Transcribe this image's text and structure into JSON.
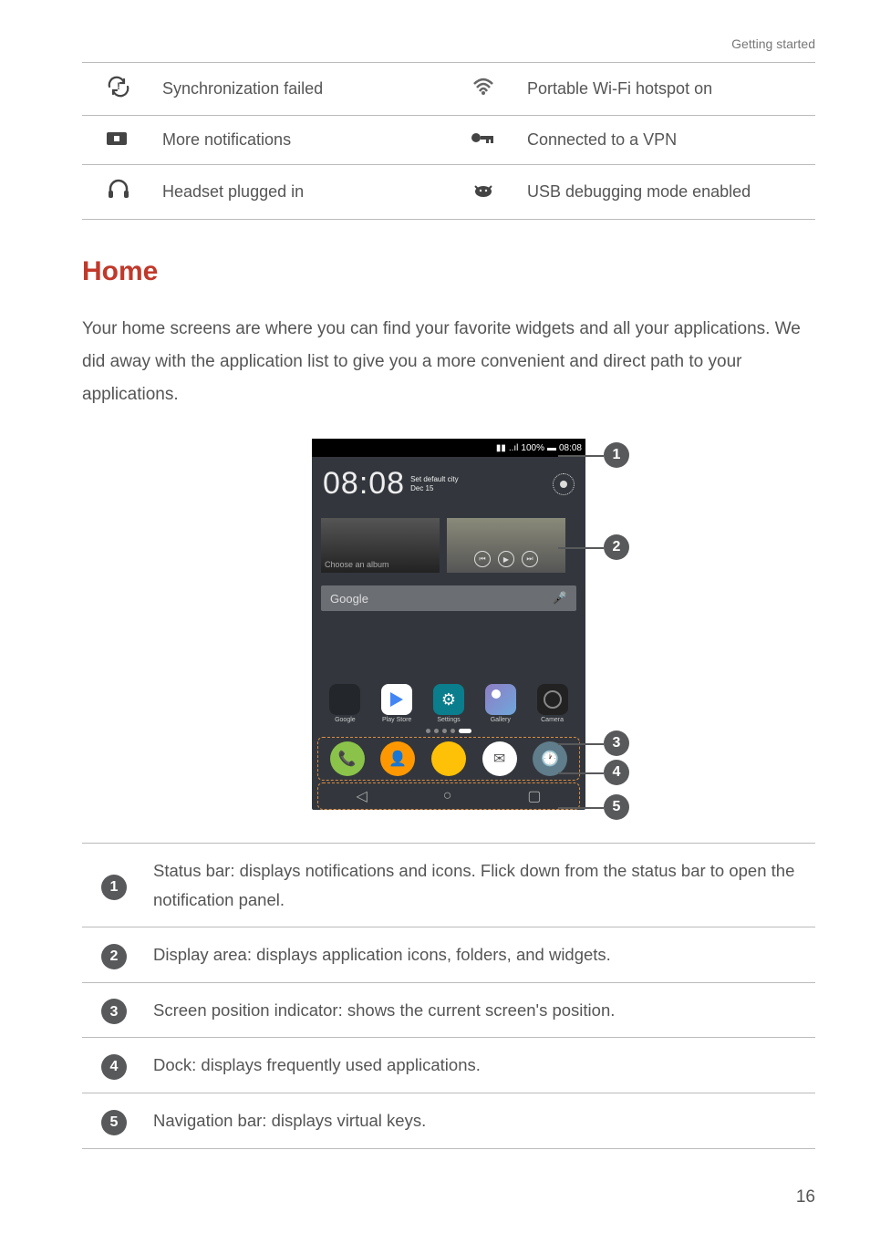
{
  "header": "Getting started",
  "icon_table": [
    {
      "left_icon": "sync-failed-icon",
      "left_text": "Synchronization failed",
      "right_icon": "wifi-hotspot-icon",
      "right_text": "Portable Wi-Fi hotspot on"
    },
    {
      "left_icon": "more-notifications-icon",
      "left_text": "More notifications",
      "right_icon": "vpn-icon",
      "right_text": "Connected to a VPN"
    },
    {
      "left_icon": "headset-icon",
      "left_text": "Headset plugged in",
      "right_icon": "usb-debug-icon",
      "right_text": "USB debugging mode enabled"
    }
  ],
  "section_title": "Home",
  "body_text": "Your home screens are where you can find your favorite widgets and all your applications. We did away with the application list to give you a more convenient and direct path to your applications.",
  "phone": {
    "status_battery": "100%",
    "status_time": "08:08",
    "clock_time": "08:08",
    "clock_city": "Set default city",
    "clock_date": "Dec 15",
    "album_label": "Choose an album",
    "google_label": "Google",
    "apps": [
      {
        "label": "Google"
      },
      {
        "label": "Play Store"
      },
      {
        "label": "Settings"
      },
      {
        "label": "Gallery"
      },
      {
        "label": "Camera"
      }
    ]
  },
  "descriptions": [
    {
      "num": "1",
      "text": "Status bar: displays notifications and icons. Flick down from the status bar to open the notification panel."
    },
    {
      "num": "2",
      "text": "Display area: displays application icons, folders, and widgets."
    },
    {
      "num": "3",
      "text": "Screen position indicator: shows the current screen's position."
    },
    {
      "num": "4",
      "text": "Dock: displays frequently used applications."
    },
    {
      "num": "5",
      "text": "Navigation bar: displays virtual keys."
    }
  ],
  "page_number": "16"
}
